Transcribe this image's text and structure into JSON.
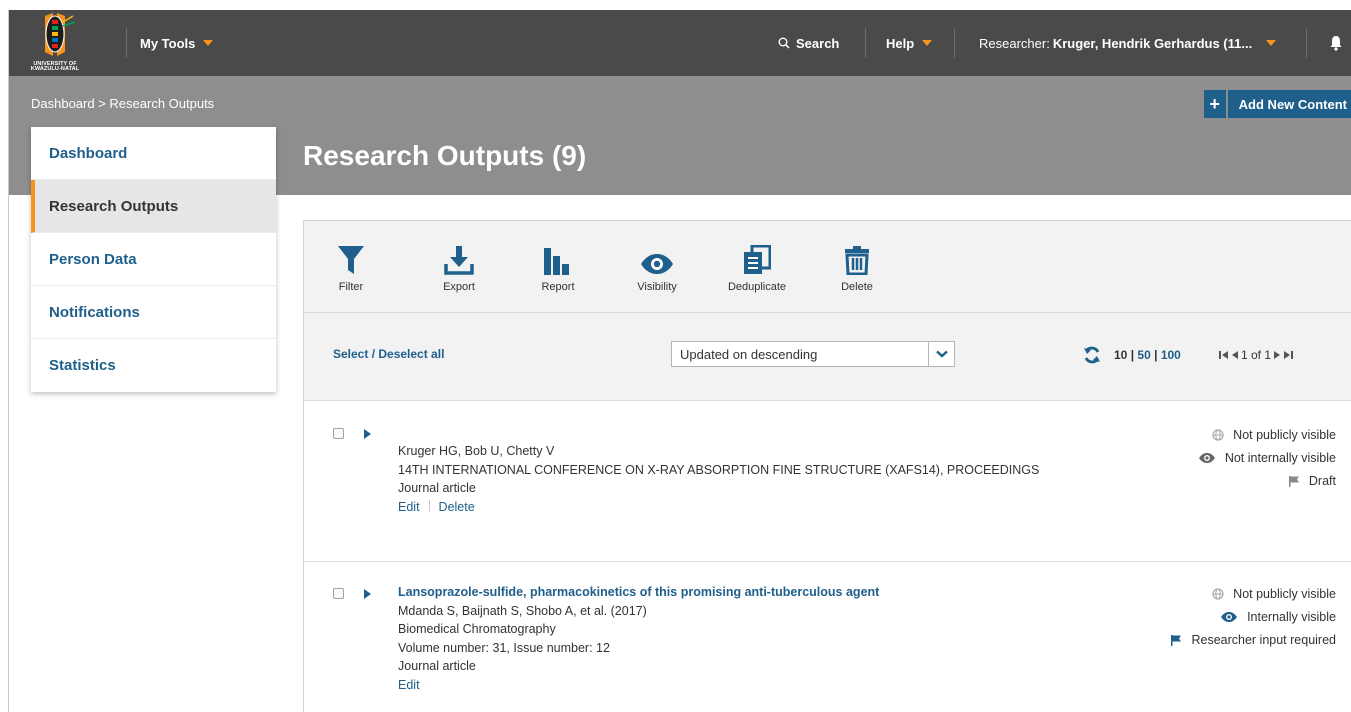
{
  "topbar": {
    "logo_text_line1": "UNIVERSITY OF",
    "logo_text_line2": "KWAZULU-NATAL",
    "my_tools": "My Tools",
    "search": "Search",
    "help": "Help",
    "researcher_prefix": "Researcher:",
    "researcher_name": "Kruger, Hendrik Gerhardus (11..."
  },
  "breadcrumb": "Dashboard > Research Outputs",
  "add_button": {
    "plus": "+",
    "label": "Add New Content"
  },
  "page_title": "Research Outputs (9)",
  "sidebar": {
    "items": [
      {
        "label": "Dashboard"
      },
      {
        "label": "Research Outputs"
      },
      {
        "label": "Person Data"
      },
      {
        "label": "Notifications"
      },
      {
        "label": "Statistics"
      }
    ]
  },
  "toolbar": {
    "filter": "Filter",
    "export": "Export",
    "report": "Report",
    "visibility": "Visibility",
    "deduplicate": "Deduplicate",
    "delete": "Delete"
  },
  "listbar": {
    "select_all": "Select / Deselect all",
    "sort_value": "Updated on descending",
    "size_10": "10",
    "size_50": "50",
    "size_100": "100",
    "pager": "1 of 1"
  },
  "records": [
    {
      "authors": "Kruger HG, Bob U, Chetty V",
      "source": "14TH INTERNATIONAL CONFERENCE ON X-RAY ABSORPTION FINE STRUCTURE (XAFS14), PROCEEDINGS",
      "type": "Journal article",
      "edit": "Edit",
      "delete": "Delete",
      "status_public": "Not publicly visible",
      "status_internal": "Not internally visible",
      "status_workflow": "Draft"
    },
    {
      "title": "Lansoprazole-sulfide, pharmacokinetics of this promising anti-tuberculous agent",
      "authors": "Mdanda S, Baijnath S, Shobo A, et al. (2017)",
      "journal": "Biomedical Chromatography",
      "volume": "Volume number: 31, Issue number: 12",
      "type": "Journal article",
      "edit": "Edit",
      "status_public": "Not publicly visible",
      "status_internal": "Internally visible",
      "status_workflow": "Researcher input required"
    }
  ],
  "colors": {
    "accent_orange": "#f7941d",
    "link_blue": "#1f5f8b",
    "topbar": "#4a4a4a",
    "band": "#8e8e8e"
  }
}
